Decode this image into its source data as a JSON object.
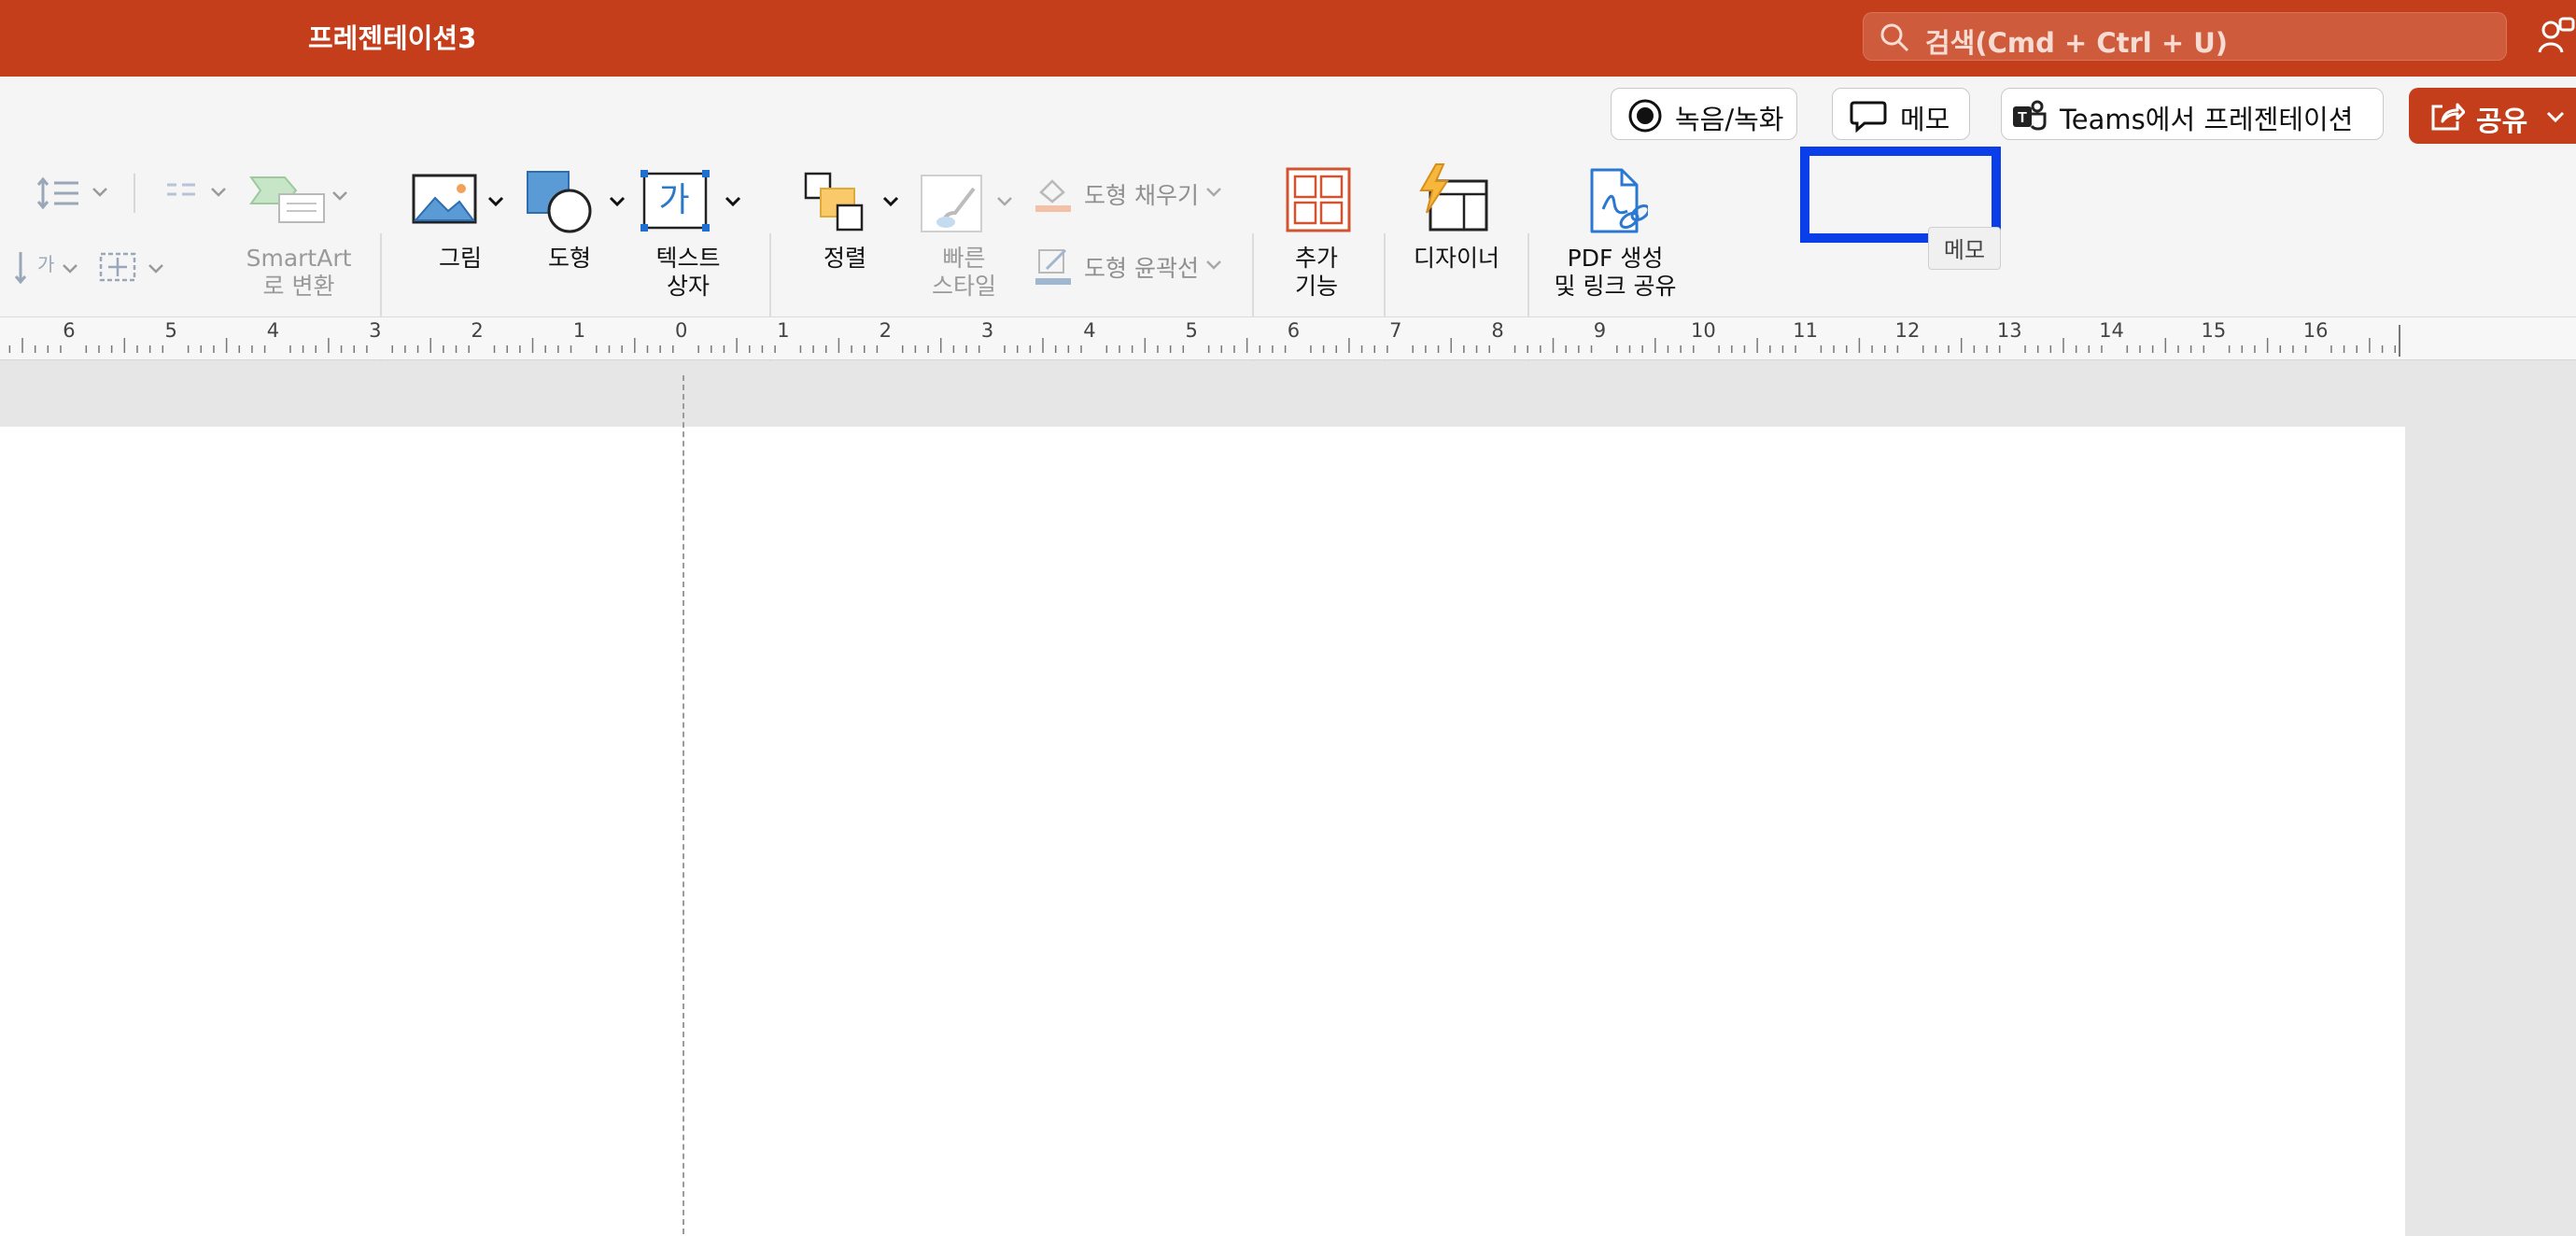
{
  "titlebar": {
    "doc_title": "프레젠테이션3",
    "search_placeholder": "검색(Cmd + Ctrl + U)",
    "accent": "#c43e1c"
  },
  "ribbon": {
    "record_label": "녹음/녹화",
    "memo_label": "메모",
    "teams_label": "Teams에서 프레젠테이션",
    "share_label": "공유",
    "tooltip": "메모",
    "smartart_label": [
      "SmartArt",
      "로 변환"
    ],
    "picture_label": "그림",
    "shape_label": "도형",
    "textbox_label": [
      "텍스트",
      "상자"
    ],
    "arrange_label": "정렬",
    "quickstyle_label": [
      "빠른",
      "스타일"
    ],
    "shape_fill_label": "도형 채우기",
    "shape_outline_label": "도형 윤곽선",
    "addins_label": [
      "추가",
      "기능"
    ],
    "designer_label": "디자이너",
    "pdf_label": [
      "PDF 생성",
      "및 링크 공유"
    ],
    "textbox_glyph": "가"
  },
  "ruler": {
    "numbers": [
      "6",
      "5",
      "4",
      "3",
      "2",
      "1",
      "0",
      "1",
      "2",
      "3",
      "4",
      "5",
      "6",
      "7",
      "8",
      "9",
      "10",
      "11",
      "12",
      "13",
      "14",
      "15",
      "16"
    ]
  }
}
